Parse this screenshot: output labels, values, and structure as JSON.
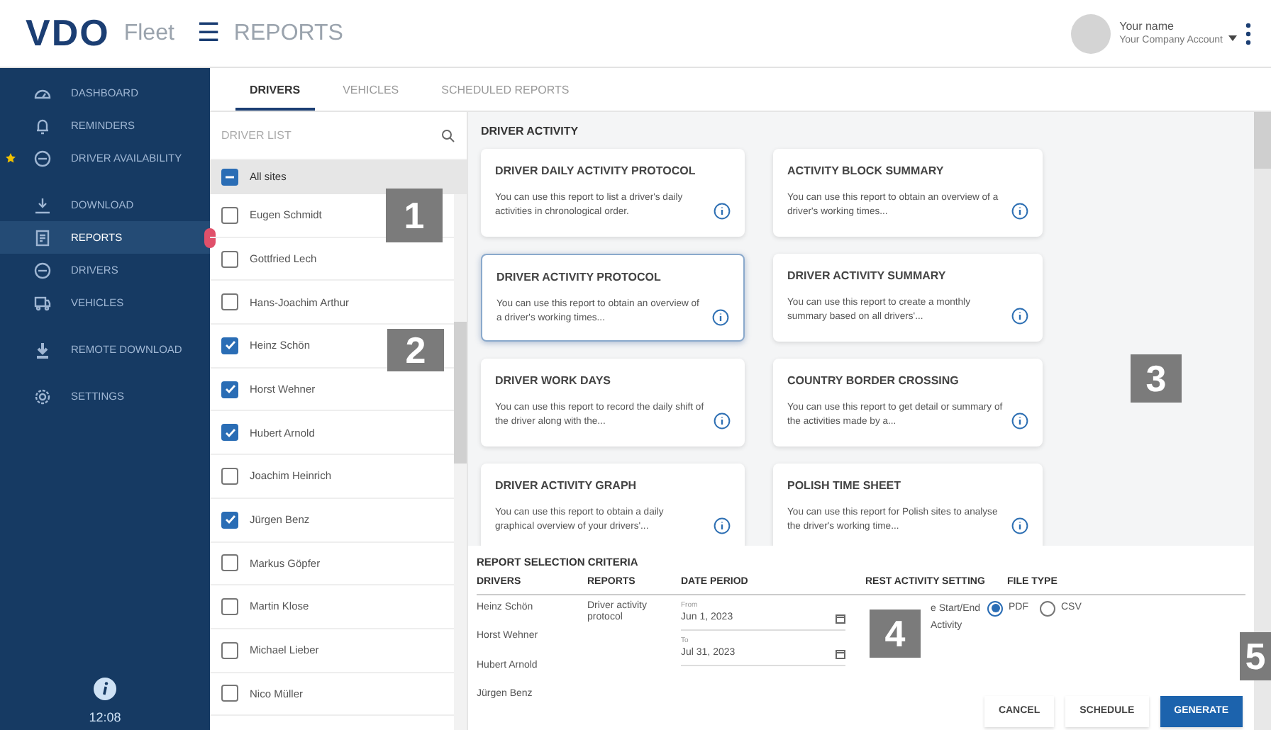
{
  "header": {
    "logo": "VDO",
    "product": "Fleet",
    "menu_glyph": "☰",
    "title": "REPORTS",
    "user_name": "Your name",
    "account": "Your Company Account"
  },
  "sidebar": {
    "groups": [
      [
        {
          "label": "DASHBOARD",
          "selected": false,
          "starred": false
        },
        {
          "label": "REMINDERS",
          "selected": false,
          "starred": false
        },
        {
          "label": "DRIVER AVAILABILITY",
          "selected": false,
          "starred": true
        }
      ],
      [
        {
          "label": "DOWNLOAD",
          "selected": false,
          "starred": false
        },
        {
          "label": "REPORTS",
          "selected": true,
          "starred": false
        },
        {
          "label": "DRIVERS",
          "selected": false,
          "starred": false
        },
        {
          "label": "VEHICLES",
          "selected": false,
          "starred": false
        }
      ],
      [
        {
          "label": "REMOTE DOWNLOAD",
          "selected": false,
          "starred": false
        }
      ],
      [
        {
          "label": "SETTINGS",
          "selected": false,
          "starred": false
        }
      ]
    ],
    "time": "12:08"
  },
  "tabs": [
    {
      "label": "DRIVERS",
      "selected": true
    },
    {
      "label": "VEHICLES",
      "selected": false
    },
    {
      "label": "SCHEDULED REPORTS",
      "selected": false
    }
  ],
  "driver_list": {
    "placeholder": "DRIVER LIST",
    "all_sites": {
      "label": "All sites",
      "indeterminate": true
    },
    "drivers": [
      {
        "name": "Eugen Schmidt",
        "checked": false
      },
      {
        "name": "Gottfried Lech",
        "checked": false
      },
      {
        "name": "Hans-Joachim Arthur",
        "checked": false
      },
      {
        "name": "Heinz Schön",
        "checked": true
      },
      {
        "name": "Horst Wehner",
        "checked": true
      },
      {
        "name": "Hubert Arnold",
        "checked": true
      },
      {
        "name": "Joachim Heinrich",
        "checked": false
      },
      {
        "name": "Jürgen Benz",
        "checked": true
      },
      {
        "name": "Markus Göpfer",
        "checked": false
      },
      {
        "name": "Martin Klose",
        "checked": false
      },
      {
        "name": "Michael Lieber",
        "checked": false
      },
      {
        "name": "Nico Müller",
        "checked": false
      }
    ]
  },
  "section_title": "DRIVER ACTIVITY",
  "reports": [
    {
      "title": "DRIVER DAILY ACTIVITY PROTOCOL",
      "description": "You can use this report to list a driver's daily activities in chronological order.",
      "selected": false
    },
    {
      "title": "ACTIVITY BLOCK SUMMARY",
      "description": "You can use this report to obtain an overview of a driver's working times...",
      "selected": false
    },
    {
      "title": "DRIVER ACTIVITY PROTOCOL",
      "description": "You can use this report to obtain an overview of a driver's working times...",
      "selected": true
    },
    {
      "title": "DRIVER ACTIVITY SUMMARY",
      "description": "You can use this report to create a monthly summary based on all drivers'...",
      "selected": false
    },
    {
      "title": "DRIVER WORK DAYS",
      "description": "You can use this report to record the daily shift of the driver along with the...",
      "selected": false
    },
    {
      "title": "COUNTRY BORDER CROSSING",
      "description": "You can use this report to get detail or summary of the activities made by a...",
      "selected": false
    },
    {
      "title": "DRIVER ACTIVITY GRAPH",
      "description": "You can use this report to obtain a daily graphical overview of your drivers'...",
      "selected": false
    },
    {
      "title": "POLISH TIME SHEET",
      "description": "You can use this report for Polish sites to analyse the driver's working time...",
      "selected": false
    }
  ],
  "criteria": {
    "title": "REPORT SELECTION CRITERIA",
    "columns": [
      "DRIVERS",
      "REPORTS",
      "DATE PERIOD",
      "REST ACTIVITY SETTING",
      "FILE TYPE"
    ],
    "drivers": [
      "Heinz Schön",
      "Horst Wehner",
      "Hubert Arnold",
      "Jürgen Benz"
    ],
    "report": "Driver activity protocol",
    "from_label": "From",
    "from": "Jun 1, 2023",
    "to_label": "To",
    "to": "Jul 31, 2023",
    "rest_setting": "e Start/End Activity",
    "file_types": [
      {
        "label": "PDF",
        "selected": true
      },
      {
        "label": "CSV",
        "selected": false
      }
    ],
    "buttons": [
      {
        "label": "CANCEL",
        "kind": "plain"
      },
      {
        "label": "SCHEDULE",
        "kind": "plain"
      },
      {
        "label": "GENERATE",
        "kind": "primary"
      }
    ]
  },
  "callouts": [
    "1",
    "2",
    "3",
    "4",
    "5"
  ]
}
